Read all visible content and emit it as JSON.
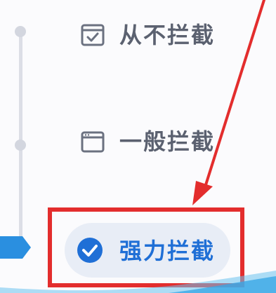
{
  "block_level": {
    "options": [
      {
        "label": "从不拦截",
        "icon": "checked-window-icon",
        "selected": false
      },
      {
        "label": "一般拦截",
        "icon": "window-icon",
        "selected": false
      },
      {
        "label": "强力拦截",
        "icon": "check-circle-icon",
        "selected": true
      }
    ]
  },
  "colors": {
    "selected_text": "#1f6fd6",
    "option_text": "#5b6170",
    "annotation_red": "#e32d2d",
    "slider_blue": "#2a8fe0"
  }
}
